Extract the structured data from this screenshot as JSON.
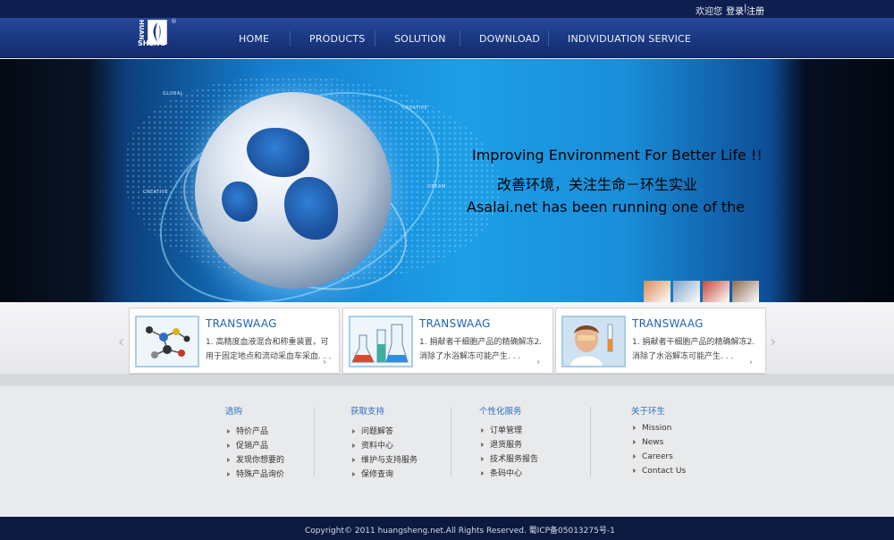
{
  "topbar": {
    "welcome": "欢迎您",
    "login": "登录",
    "separator": "|",
    "register": "注册"
  },
  "logo": {
    "line1": "HUAN",
    "line2": "SHENG",
    "reg_mark": "®"
  },
  "nav": [
    {
      "label": "HOME"
    },
    {
      "label": "PRODUCTS"
    },
    {
      "label": "SOLUTION"
    },
    {
      "label": "DOWNLOAD"
    },
    {
      "label": "INDIVIDUATION SERVICE"
    }
  ],
  "banner": {
    "headline": "Improving Environment For Better Life !!",
    "subline": "改善环境，关注生命－环生实业",
    "small_text": "Asalai.net has been running one of the biggest domain and web hosting sites in Korea since May 1998. More than 3,000,000 users with aslai.com, for domain registration, web hosting, web programming, and homepage building services.",
    "map_labels": [
      "GLOBAL",
      "CREATIVE",
      "DREAM",
      "CREATIVE"
    ],
    "thumb_colors": [
      "#d98a5a",
      "#7fa4c9",
      "#c34a3a",
      "#8a6a52"
    ]
  },
  "products": {
    "prev_label": "‹",
    "next_label": "›",
    "cards": [
      {
        "title": "TRANSWAAG",
        "desc": "1. 高精度血液混合和称重装置，可用于固定地点和流动采血车采血. . . .",
        "icon": "molecule-icon"
      },
      {
        "title": "TRANSWAAG",
        "desc": "1. 捐献者干细胞产品的精确解冻2. 消除了水浴解冻可能产生. . .",
        "icon": "flasks-icon"
      },
      {
        "title": "TRANSWAAG",
        "desc": "1. 捐献者干细胞产品的精确解冻2. 消除了水浴解冻可能产生. . .",
        "icon": "scientist-icon"
      }
    ],
    "more_label": "›"
  },
  "footer_columns": [
    {
      "title": "选购",
      "links": [
        "特价产品",
        "促销产品",
        "发现你想要的",
        "特殊产品询价"
      ]
    },
    {
      "title": "获取支持",
      "links": [
        "问题解答",
        "资料中心",
        "维护与支持服务",
        "保修查询"
      ]
    },
    {
      "title": "个性化服务",
      "links": [
        "订单管理",
        "退货服务",
        "技术服务报告",
        "条码中心"
      ]
    },
    {
      "title": "关于环生",
      "links": [
        "Mission",
        "News",
        "Careers",
        "Contact Us"
      ]
    }
  ],
  "copyright": "Copyright© 2011 huangsheng.net.All Rights Reserved. 蜀ICP备05013275号-1"
}
